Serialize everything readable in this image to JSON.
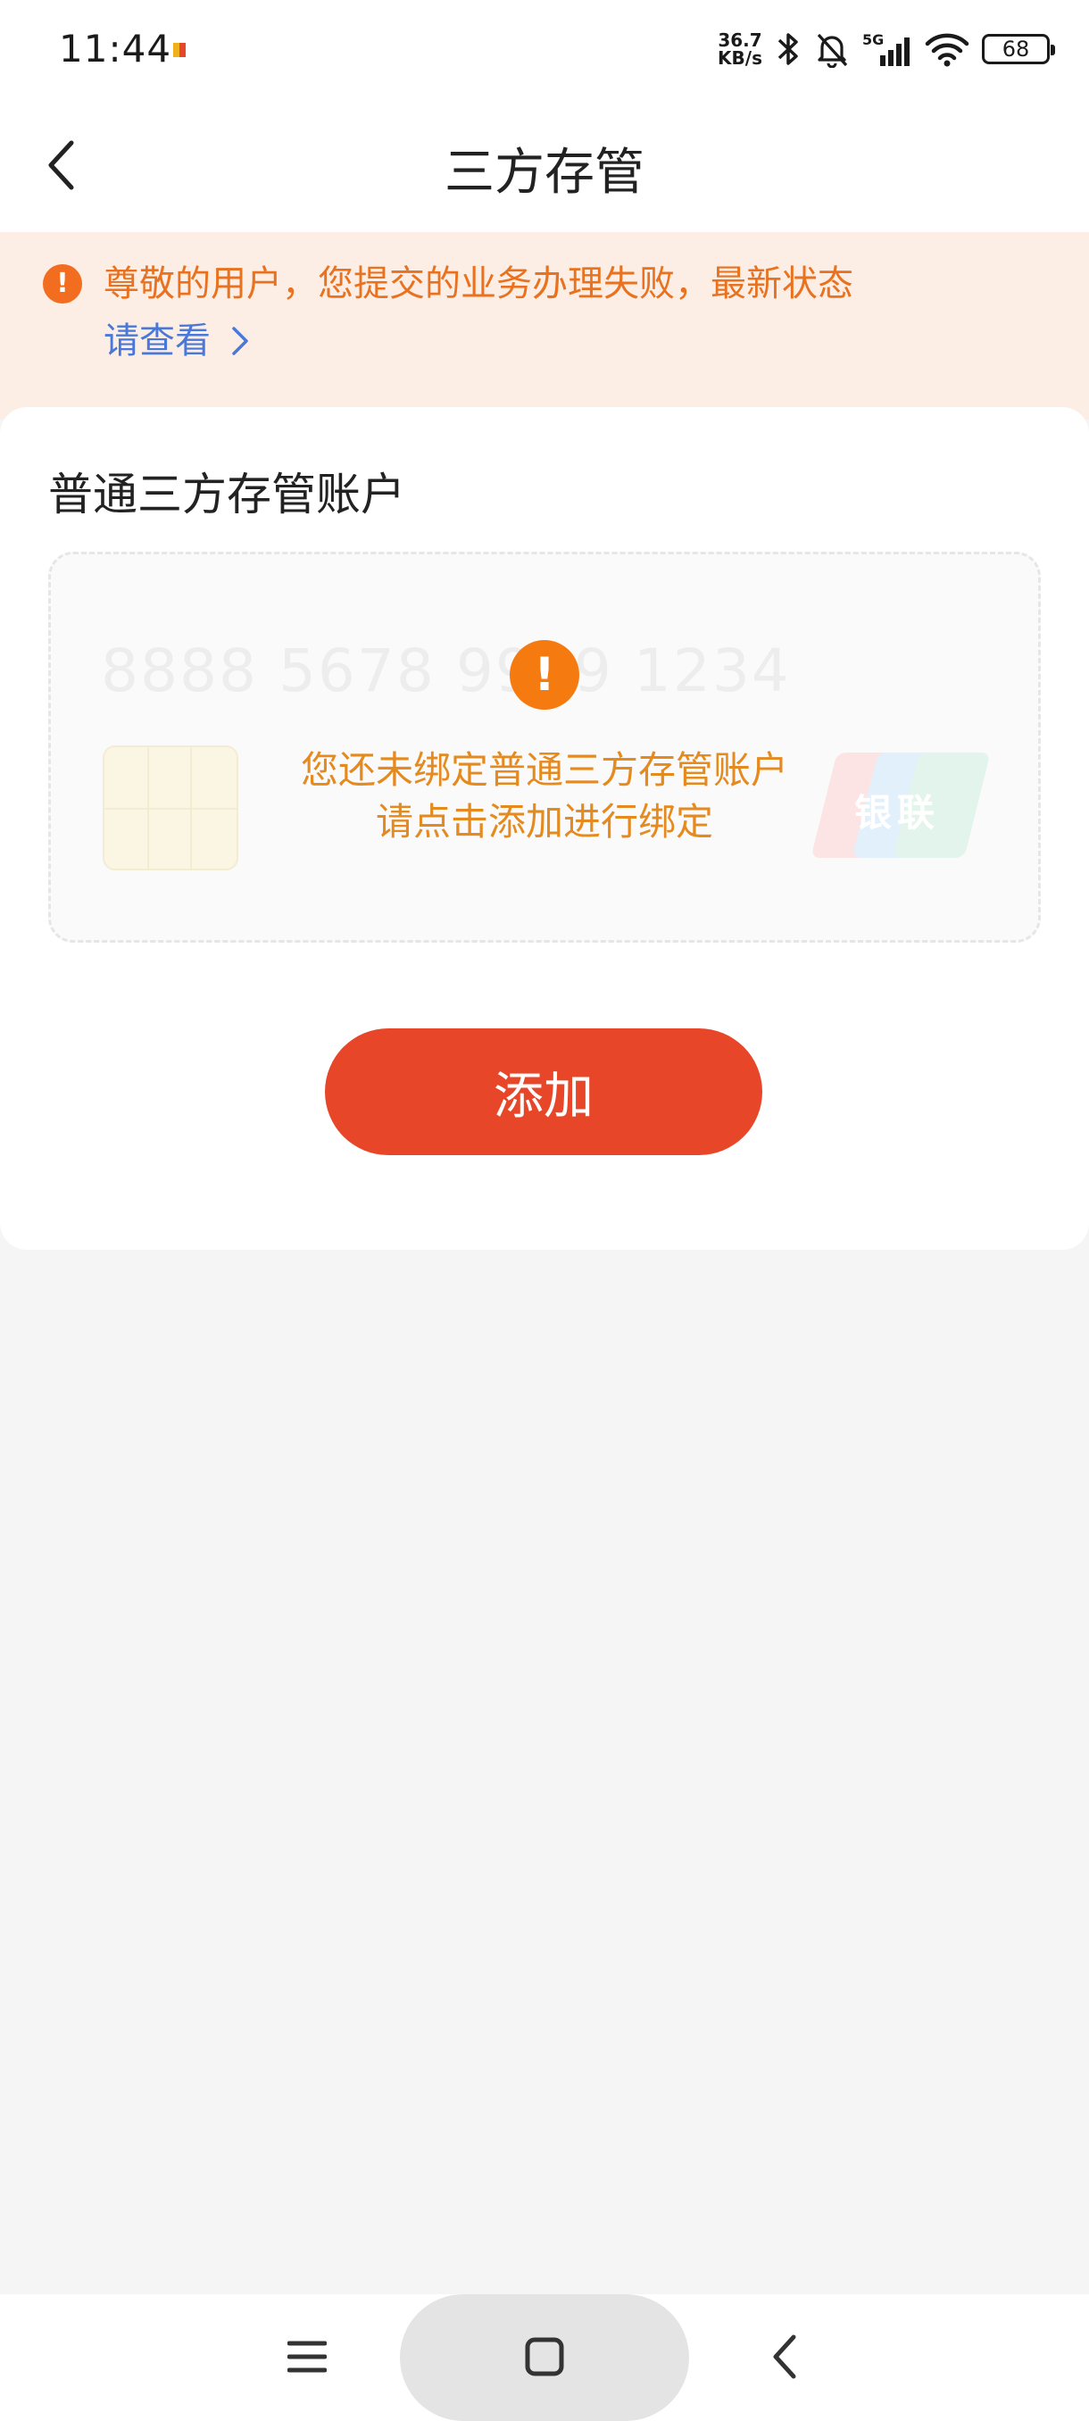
{
  "status_bar": {
    "time": "11:44",
    "net_speed_value": "36.7",
    "net_speed_unit": "KB/s",
    "signal_label": "5G",
    "battery": "68",
    "icons": [
      "bluetooth-icon",
      "bell-muted-icon",
      "signal-icon",
      "wifi-icon",
      "battery-icon"
    ]
  },
  "header": {
    "title": "三方存管"
  },
  "notice": {
    "message": "尊敬的用户，您提交的业务办理失败，最新状态",
    "link": "请查看",
    "color": "#e8721f"
  },
  "account_section": {
    "title": "普通三方存管账户",
    "card_placeholder_number": "8888 5678 9999 1234",
    "unionpay_label": "银联",
    "empty_line1": "您还未绑定普通三方存管账户",
    "empty_line2": "请点击添加进行绑定"
  },
  "actions": {
    "add_label": "添加",
    "accent": "#e84628"
  },
  "system_nav": {
    "icons": [
      "menu-icon",
      "home-icon",
      "back-icon"
    ]
  }
}
